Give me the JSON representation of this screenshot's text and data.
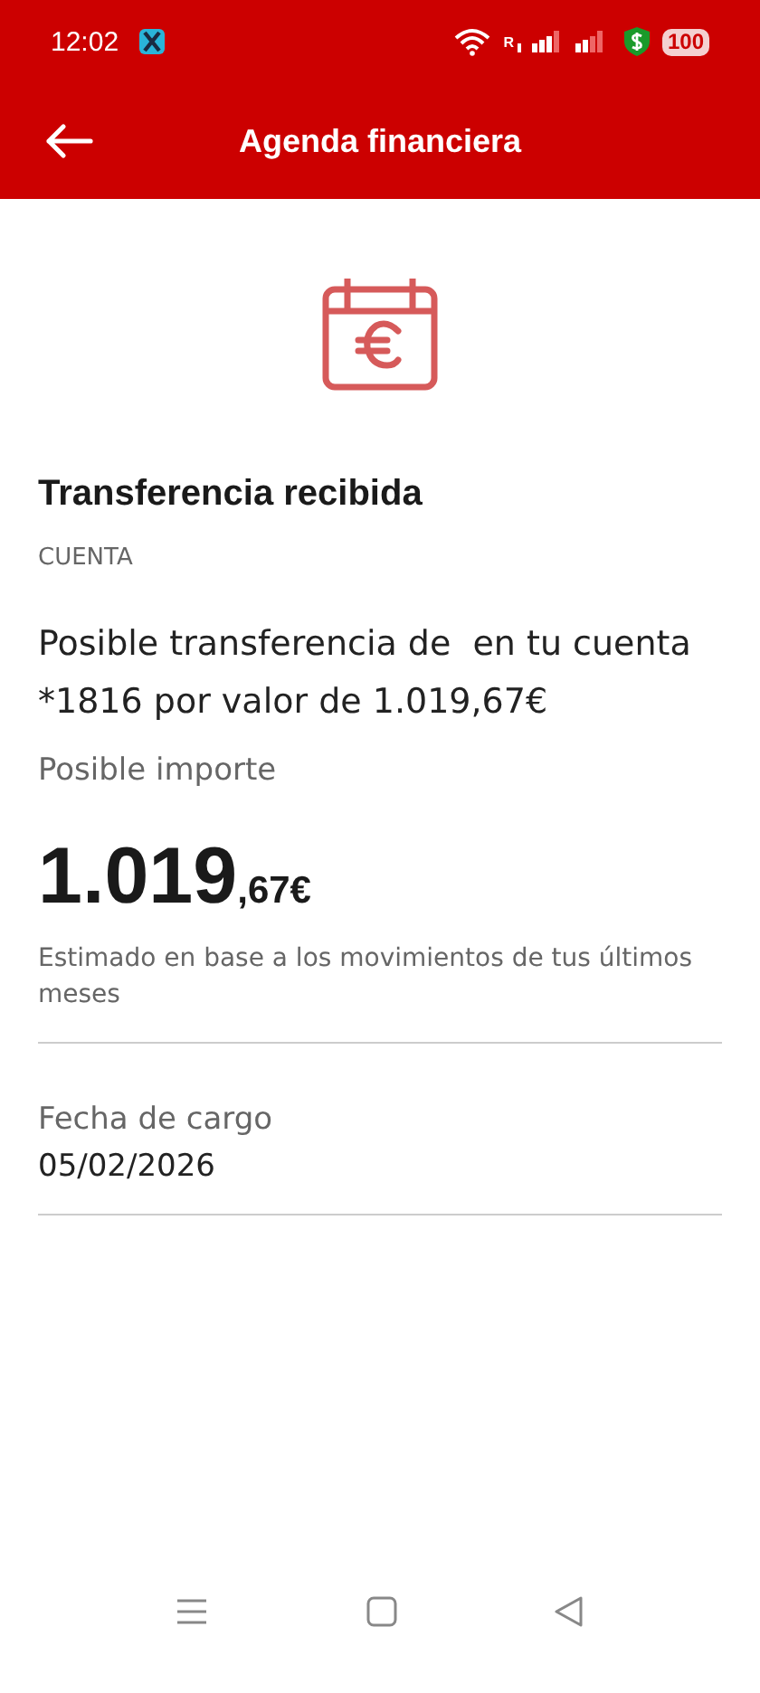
{
  "status_bar": {
    "time": "12:02",
    "roaming": "R",
    "battery": "100"
  },
  "header": {
    "title": "Agenda financiera"
  },
  "event": {
    "title": "Transferencia recibida",
    "category": "CUENTA",
    "description": "Posible transferencia de  en tu cuenta *1816 por valor de 1.019,67€"
  },
  "amount": {
    "label": "Posible importe",
    "integer": "1.019",
    "decimal": ",67€",
    "note": "Estimado en base a los movimientos de tus últimos meses"
  },
  "charge_date": {
    "label": "Fecha de cargo",
    "value": "05/02/2026"
  }
}
